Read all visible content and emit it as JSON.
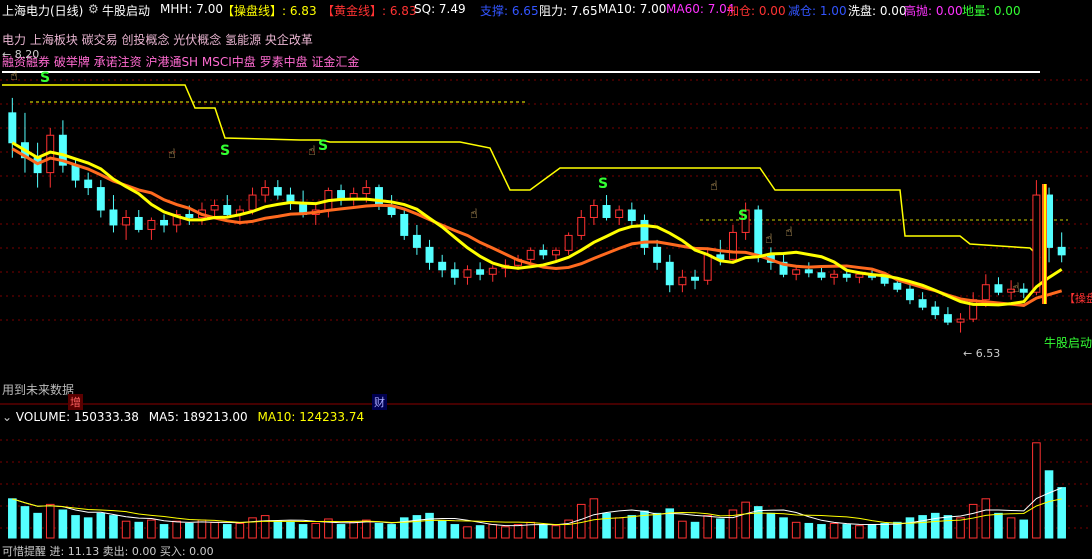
{
  "header": {
    "stock": "上海电力(日线)",
    "formula_gear_icon": "gear-icon",
    "formula": "牛股启动",
    "items": [
      {
        "label": "MHH: 7.00",
        "color": "#ffffff"
      },
      {
        "label": "【操盘线】: 6.83",
        "color": "#ffff00"
      },
      {
        "label": "【黄金线】: 6.83",
        "color": "#ff3333"
      },
      {
        "label": "SQ: 7.49",
        "color": "#ffffff"
      },
      {
        "label": "支撑: 6.65",
        "color": "#3355ff"
      },
      {
        "label": "阻力: 7.65",
        "color": "#ffffff"
      },
      {
        "label": "MA10: 7.00",
        "color": "#ffffff"
      },
      {
        "label": "MA60: 7.04",
        "color": "#ff33ff"
      },
      {
        "label": "加仓: 0.00",
        "color": "#ff3333"
      },
      {
        "label": "减仓: 1.00",
        "color": "#3355ff"
      },
      {
        "label": "洗盘: 0.00",
        "color": "#ffffff"
      },
      {
        "label": "高抛: 0.00",
        "color": "#ff33ff"
      },
      {
        "label": "地量: 0.00",
        "color": "#33ff33"
      }
    ]
  },
  "concepts_line1": "电力 上海板块 碳交易 创投概念 光伏概念 氢能源 央企改革",
  "concepts_line2": "融资融券 破举牌 承诺注资 沪港通SH MSCI中盘 罗素中盘 证金汇金",
  "price_high_label": "8.20",
  "price_low_label": "6.53",
  "future_data_note": "用到未来数据",
  "marker_zeng": "增",
  "marker_cai": "财",
  "signal_s": "S",
  "right_label_caopan": "【操盘",
  "right_label_niugu": "牛股启动",
  "volume_header": {
    "volume": "VOLUME: 150333.38",
    "ma5": "MA5: 189213.00",
    "ma10": "MA10: 124233.74"
  },
  "bottom_partial": "可惜提醒     进: 11.13  卖出: 0.00    买入: 0.00",
  "colors": {
    "up": "#ff3232",
    "down": "#54ffff",
    "operate_line": "#ffff00",
    "gold_line": "#ff6a1f",
    "step_line": "#ffff00",
    "ma5_vol": "#ffffff",
    "ma10_vol": "#ffff00"
  },
  "chart_data": {
    "type": "candlestick",
    "price_range": [
      6.4,
      8.3
    ],
    "bars": [
      [
        8.0,
        8.1,
        7.7,
        7.8
      ],
      [
        7.8,
        8.0,
        7.6,
        7.7
      ],
      [
        7.7,
        7.8,
        7.5,
        7.6
      ],
      [
        7.6,
        7.9,
        7.5,
        7.85
      ],
      [
        7.85,
        7.95,
        7.6,
        7.65
      ],
      [
        7.65,
        7.7,
        7.5,
        7.55
      ],
      [
        7.55,
        7.6,
        7.45,
        7.5
      ],
      [
        7.5,
        7.55,
        7.3,
        7.35
      ],
      [
        7.35,
        7.45,
        7.2,
        7.25
      ],
      [
        7.25,
        7.35,
        7.15,
        7.3
      ],
      [
        7.3,
        7.35,
        7.2,
        7.22
      ],
      [
        7.22,
        7.3,
        7.15,
        7.28
      ],
      [
        7.28,
        7.32,
        7.2,
        7.25
      ],
      [
        7.25,
        7.35,
        7.2,
        7.32
      ],
      [
        7.32,
        7.38,
        7.25,
        7.3
      ],
      [
        7.3,
        7.4,
        7.25,
        7.35
      ],
      [
        7.35,
        7.42,
        7.3,
        7.38
      ],
      [
        7.38,
        7.45,
        7.3,
        7.32
      ],
      [
        7.32,
        7.38,
        7.25,
        7.35
      ],
      [
        7.35,
        7.5,
        7.32,
        7.45
      ],
      [
        7.45,
        7.55,
        7.4,
        7.5
      ],
      [
        7.5,
        7.55,
        7.42,
        7.45
      ],
      [
        7.45,
        7.5,
        7.35,
        7.4
      ],
      [
        7.4,
        7.48,
        7.3,
        7.32
      ],
      [
        7.32,
        7.4,
        7.25,
        7.35
      ],
      [
        7.35,
        7.5,
        7.3,
        7.48
      ],
      [
        7.48,
        7.52,
        7.38,
        7.42
      ],
      [
        7.42,
        7.5,
        7.38,
        7.46
      ],
      [
        7.46,
        7.55,
        7.4,
        7.5
      ],
      [
        7.5,
        7.52,
        7.35,
        7.38
      ],
      [
        7.38,
        7.45,
        7.3,
        7.32
      ],
      [
        7.32,
        7.35,
        7.15,
        7.18
      ],
      [
        7.18,
        7.25,
        7.05,
        7.1
      ],
      [
        7.1,
        7.15,
        6.95,
        7.0
      ],
      [
        7.0,
        7.05,
        6.9,
        6.95
      ],
      [
        6.95,
        7.0,
        6.85,
        6.9
      ],
      [
        6.9,
        6.98,
        6.85,
        6.95
      ],
      [
        6.95,
        7.0,
        6.88,
        6.92
      ],
      [
        6.92,
        6.98,
        6.87,
        6.96
      ],
      [
        6.96,
        7.02,
        6.9,
        6.98
      ],
      [
        6.98,
        7.05,
        6.95,
        7.02
      ],
      [
        7.02,
        7.1,
        7.0,
        7.08
      ],
      [
        7.08,
        7.12,
        7.02,
        7.05
      ],
      [
        7.05,
        7.1,
        7.0,
        7.08
      ],
      [
        7.08,
        7.2,
        7.05,
        7.18
      ],
      [
        7.18,
        7.35,
        7.15,
        7.3
      ],
      [
        7.3,
        7.42,
        7.25,
        7.38
      ],
      [
        7.38,
        7.45,
        7.28,
        7.3
      ],
      [
        7.3,
        7.38,
        7.25,
        7.35
      ],
      [
        7.35,
        7.4,
        7.25,
        7.28
      ],
      [
        7.28,
        7.32,
        7.05,
        7.1
      ],
      [
        7.1,
        7.15,
        6.95,
        7.0
      ],
      [
        7.0,
        7.05,
        6.8,
        6.85
      ],
      [
        6.85,
        6.95,
        6.8,
        6.9
      ],
      [
        6.9,
        6.95,
        6.82,
        6.88
      ],
      [
        6.88,
        7.1,
        6.85,
        7.05
      ],
      [
        7.05,
        7.15,
        6.98,
        7.02
      ],
      [
        7.02,
        7.25,
        7.0,
        7.2
      ],
      [
        7.2,
        7.4,
        7.15,
        7.35
      ],
      [
        7.35,
        7.38,
        7.0,
        7.05
      ],
      [
        7.05,
        7.1,
        6.95,
        7.0
      ],
      [
        7.0,
        7.05,
        6.9,
        6.92
      ],
      [
        6.92,
        6.98,
        6.88,
        6.95
      ],
      [
        6.95,
        7.0,
        6.9,
        6.93
      ],
      [
        6.93,
        6.98,
        6.88,
        6.9
      ],
      [
        6.9,
        6.95,
        6.85,
        6.92
      ],
      [
        6.92,
        6.96,
        6.87,
        6.9
      ],
      [
        6.9,
        6.94,
        6.86,
        6.92
      ],
      [
        6.92,
        6.95,
        6.88,
        6.9
      ],
      [
        6.9,
        6.93,
        6.84,
        6.86
      ],
      [
        6.86,
        6.9,
        6.8,
        6.82
      ],
      [
        6.82,
        6.86,
        6.72,
        6.75
      ],
      [
        6.75,
        6.8,
        6.68,
        6.7
      ],
      [
        6.7,
        6.74,
        6.62,
        6.65
      ],
      [
        6.65,
        6.7,
        6.58,
        6.6
      ],
      [
        6.6,
        6.66,
        6.53,
        6.62
      ],
      [
        6.62,
        6.8,
        6.6,
        6.75
      ],
      [
        6.75,
        6.92,
        6.7,
        6.85
      ],
      [
        6.85,
        6.9,
        6.78,
        6.8
      ],
      [
        6.8,
        6.88,
        6.75,
        6.82
      ],
      [
        6.82,
        6.86,
        6.76,
        6.8
      ],
      [
        6.8,
        7.55,
        6.78,
        7.45
      ],
      [
        7.45,
        7.5,
        7.0,
        7.1
      ],
      [
        7.1,
        7.2,
        7.0,
        7.05
      ]
    ],
    "volume_max": 1.0,
    "volumes": [
      0.35,
      0.28,
      0.22,
      0.3,
      0.25,
      0.2,
      0.18,
      0.22,
      0.2,
      0.15,
      0.14,
      0.16,
      0.12,
      0.15,
      0.13,
      0.16,
      0.14,
      0.12,
      0.13,
      0.18,
      0.2,
      0.15,
      0.14,
      0.12,
      0.13,
      0.17,
      0.12,
      0.14,
      0.16,
      0.13,
      0.12,
      0.18,
      0.2,
      0.22,
      0.15,
      0.12,
      0.1,
      0.11,
      0.12,
      0.1,
      0.12,
      0.14,
      0.12,
      0.11,
      0.16,
      0.3,
      0.35,
      0.22,
      0.18,
      0.2,
      0.24,
      0.22,
      0.26,
      0.15,
      0.14,
      0.2,
      0.17,
      0.25,
      0.32,
      0.28,
      0.22,
      0.18,
      0.14,
      0.13,
      0.12,
      0.13,
      0.12,
      0.11,
      0.12,
      0.13,
      0.14,
      0.18,
      0.2,
      0.22,
      0.2,
      0.18,
      0.3,
      0.35,
      0.22,
      0.18,
      0.16,
      0.85,
      0.6,
      0.45
    ]
  }
}
